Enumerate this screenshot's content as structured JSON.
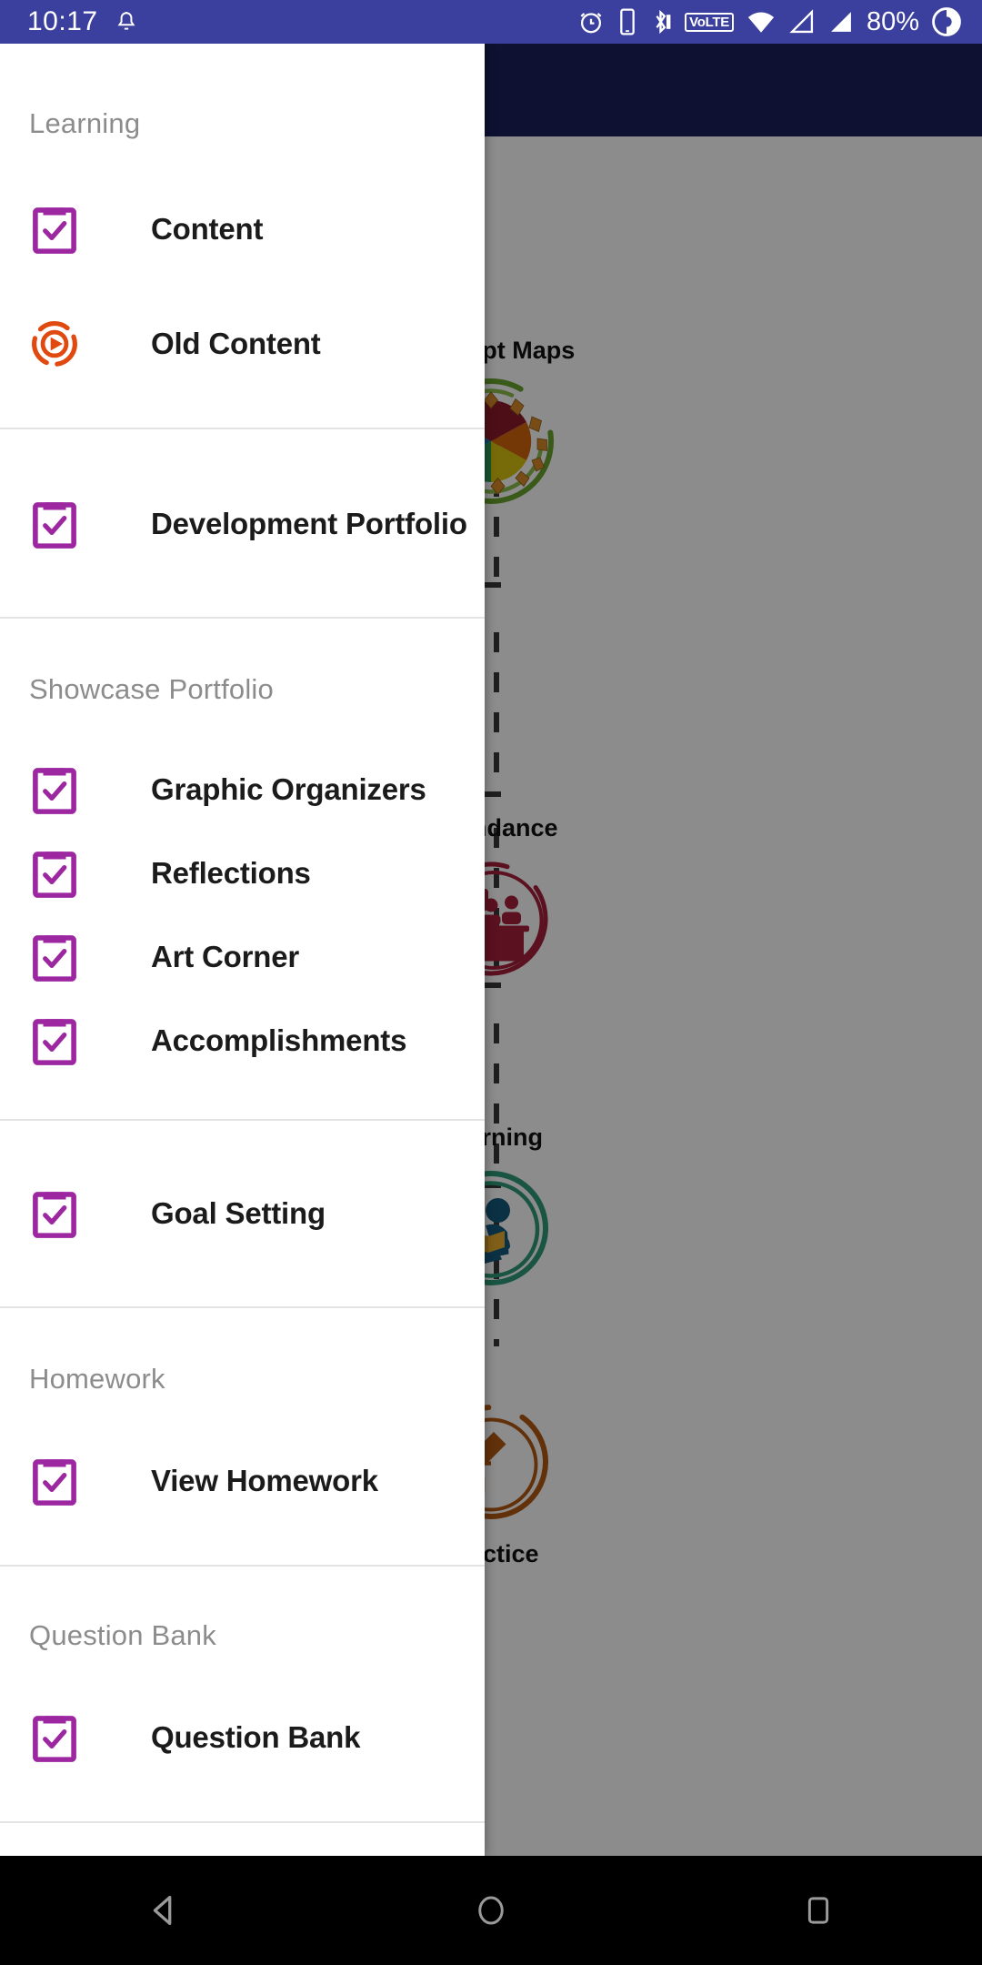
{
  "status_bar": {
    "time": "10:17",
    "battery": "80%",
    "volte_label": "VoLTE",
    "icons": [
      "notification-bell-icon",
      "alarm-icon",
      "phone-icon",
      "bluetooth-icon",
      "volte-icon",
      "wifi-icon",
      "signal-1-icon",
      "signal-2-icon",
      "screen-record-icon"
    ],
    "background_color": "#3b3f9e"
  },
  "drawer": {
    "accent_color": "#9c27a0",
    "groups": [
      {
        "header": "Learning",
        "items": [
          {
            "label": "Content",
            "icon": "clipboard-check-icon"
          },
          {
            "label": "Old Content",
            "icon": "play-circle-icon"
          }
        ]
      },
      {
        "header": "",
        "items": [
          {
            "label": "Development Portfolio",
            "icon": "clipboard-check-icon"
          }
        ]
      },
      {
        "header": "Showcase Portfolio",
        "items": [
          {
            "label": "Graphic Organizers",
            "icon": "clipboard-check-icon"
          },
          {
            "label": "Reflections",
            "icon": "clipboard-check-icon"
          },
          {
            "label": "Art Corner",
            "icon": "clipboard-check-icon"
          },
          {
            "label": "Accomplishments",
            "icon": "clipboard-check-icon"
          }
        ]
      },
      {
        "header": "",
        "items": [
          {
            "label": "Goal Setting",
            "icon": "clipboard-check-icon"
          }
        ]
      },
      {
        "header": "Homework",
        "items": [
          {
            "label": "View Homework",
            "icon": "clipboard-check-icon"
          }
        ]
      },
      {
        "header": "Question Bank",
        "items": [
          {
            "label": "Question Bank",
            "icon": "clipboard-check-icon"
          }
        ]
      }
    ]
  },
  "background": {
    "app_bar_color": "#1b2059",
    "roadmap": [
      {
        "label": "Concept Maps",
        "icon": "concept-map-wheel-icon",
        "color": "#6aa52e"
      },
      {
        "label": "Attendance",
        "icon": "attendance-classroom-icon",
        "color": "#a81f3c"
      },
      {
        "label": "Learning",
        "icon": "learning-reader-icon",
        "color": "#2f9b78"
      },
      {
        "label": "Practice",
        "icon": "practice-pencil-icon",
        "color": "#b35a13"
      }
    ]
  },
  "nav_bar": {
    "buttons": [
      {
        "name": "back",
        "icon": "back-triangle-icon"
      },
      {
        "name": "home",
        "icon": "home-circle-icon"
      },
      {
        "name": "recents",
        "icon": "recents-square-icon"
      }
    ]
  }
}
